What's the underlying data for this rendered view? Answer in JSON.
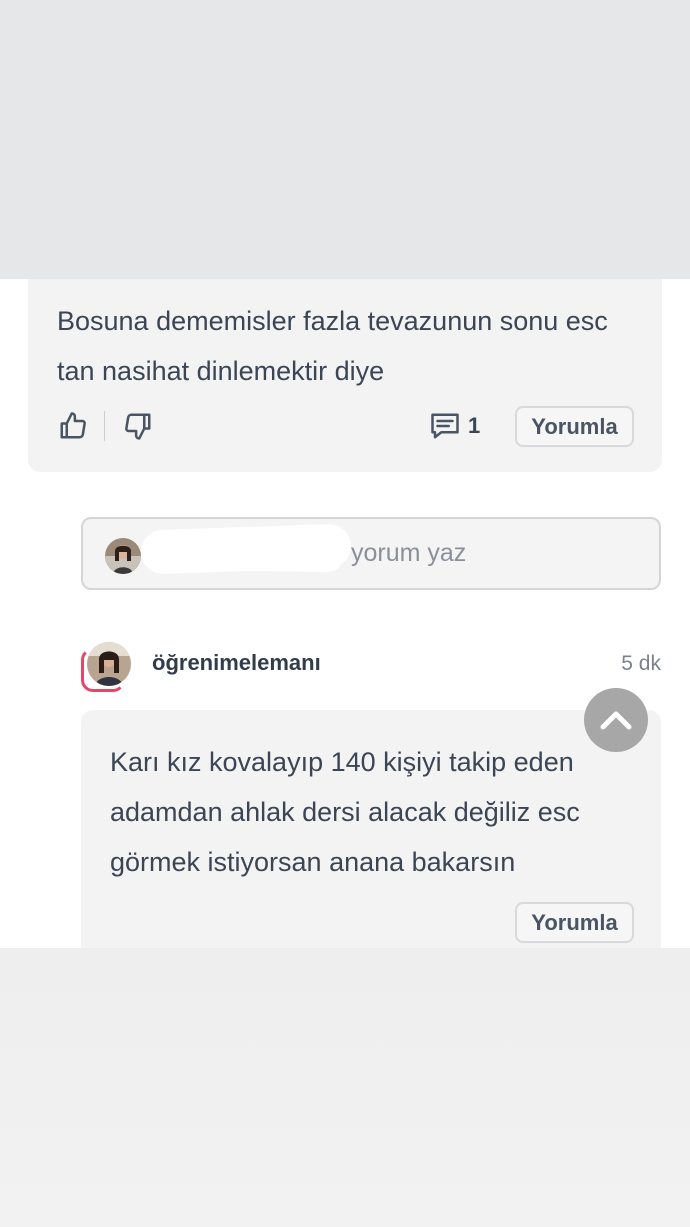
{
  "comment1": {
    "text": "Bosuna dememisler fazla tevazunun sonu esc tan nasihat dinlemektir diye",
    "comment_count": "1",
    "reply_label": "Yorumla",
    "like_icon": "thumbs-up-icon",
    "dislike_icon": "thumbs-down-icon",
    "comment_icon": "comment-icon"
  },
  "input": {
    "placeholder": "yorum yaz"
  },
  "reply": {
    "username": "öğrenimelemanı",
    "time": "5 dk",
    "text": "Karı kız kovalayıp 140 kişiyi takip eden adamdan ahlak dersi alacak değiliz esc görmek istiyorsan anana bakarsın",
    "reply_label": "Yorumla"
  },
  "scroll_top_icon": "chevron-up-icon",
  "colors": {
    "card_bg": "#f3f3f4",
    "text": "#3b4554",
    "avatar_ring": "#e9456b",
    "scroll_button": "#a7a7a7"
  }
}
